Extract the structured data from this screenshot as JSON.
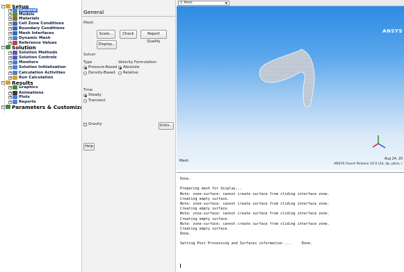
{
  "tree": {
    "items": [
      {
        "label": "Setup",
        "level": 0,
        "icon": "setup-icon",
        "color": "#d9a020"
      },
      {
        "label": "General",
        "level": 1,
        "icon": "general-icon",
        "color": "#4a7fd4",
        "selected": true
      },
      {
        "label": "Models",
        "level": 1,
        "icon": "models-icon",
        "color": "#5c8c3a"
      },
      {
        "label": "Materials",
        "level": 1,
        "icon": "materials-icon",
        "color": "#8a6a3a"
      },
      {
        "label": "Cell Zone Conditions",
        "level": 1,
        "icon": "cell-zone-icon",
        "color": "#3a6ab0"
      },
      {
        "label": "Boundary Conditions",
        "level": 1,
        "icon": "boundary-icon",
        "color": "#3a6ab0"
      },
      {
        "label": "Mesh Interfaces",
        "level": 1,
        "icon": "mesh-interfaces-icon",
        "color": "#3a6ab0"
      },
      {
        "label": "Dynamic Mesh",
        "level": 1,
        "icon": "dynamic-mesh-icon",
        "color": "#4a7fd4"
      },
      {
        "label": "Reference Values",
        "level": 1,
        "icon": "reference-values-icon",
        "color": "#c04040"
      },
      {
        "label": "Solution",
        "level": 0,
        "icon": "solution-icon",
        "color": "#3a8a3a"
      },
      {
        "label": "Solution Methods",
        "level": 1,
        "icon": "solution-methods-icon",
        "color": "#5a5ab0"
      },
      {
        "label": "Solution Controls",
        "level": 1,
        "icon": "solution-controls-icon",
        "color": "#5a5ab0"
      },
      {
        "label": "Monitors",
        "level": 1,
        "icon": "monitors-icon",
        "color": "#4a7fd4"
      },
      {
        "label": "Solution Initialization",
        "level": 1,
        "icon": "solution-init-icon",
        "color": "#4a7fd4"
      },
      {
        "label": "Calculation Activities",
        "level": 1,
        "icon": "calc-activities-icon",
        "color": "#4a7fd4"
      },
      {
        "label": "Run Calculation",
        "level": 1,
        "icon": "run-calculation-icon",
        "color": "#d9a020"
      },
      {
        "label": "Results",
        "level": 0,
        "icon": "results-icon",
        "color": "#d9a020"
      },
      {
        "label": "Graphics",
        "level": 1,
        "icon": "graphics-icon",
        "color": "#3a8a3a"
      },
      {
        "label": "Animations",
        "level": 1,
        "icon": "animations-icon",
        "color": "#3a3a3a"
      },
      {
        "label": "Plots",
        "level": 1,
        "icon": "plots-icon",
        "color": "#4a7fd4"
      },
      {
        "label": "Reports",
        "level": 1,
        "icon": "reports-icon",
        "color": "#4a7fd4"
      },
      {
        "label": "Parameters & Customization",
        "level": 0,
        "icon": "parameters-icon",
        "color": "#3a8a3a"
      }
    ]
  },
  "panel": {
    "title": "General",
    "mesh_label": "Mesh",
    "scale_btn": "Scale...",
    "check_btn": "Check",
    "report_quality_btn": "Report Quality",
    "display_btn": "Display...",
    "solver_label": "Solver",
    "type_label": "Type",
    "pressure_based": "Pressure-Based",
    "density_based": "Density-Based",
    "velocity_label": "Velocity Formulation",
    "absolute": "Absolute",
    "relative": "Relative",
    "time_label": "Time",
    "steady": "Steady",
    "transient": "Transient",
    "gravity": "Gravity",
    "units_btn": "Units...",
    "help_btn": "Help"
  },
  "graphics": {
    "view_select": "1: Mesh",
    "brand": "ANSYS",
    "caption": "Mesh",
    "date": "Aug 24, 20",
    "release": "ANSYS Fluent Release 16.0 (3d, dp, pbns, r"
  },
  "console": {
    "lines": [
      "Done.",
      "",
      "Preparing mesh for display...",
      "Note: zone-surface: cannot create surface from sliding interface zone.",
      "Creating empty surface.",
      "Note: zone-surface: cannot create surface from sliding interface zone.",
      "Creating empty surface.",
      "Note: zone-surface: cannot create surface from sliding interface zone.",
      "Creating empty surface.",
      "Note: zone-surface: cannot create surface from sliding interface zone.",
      "Creating empty surface.",
      "Done.",
      "",
      "Setting Post Processing and Surfaces information ...     Done."
    ]
  }
}
